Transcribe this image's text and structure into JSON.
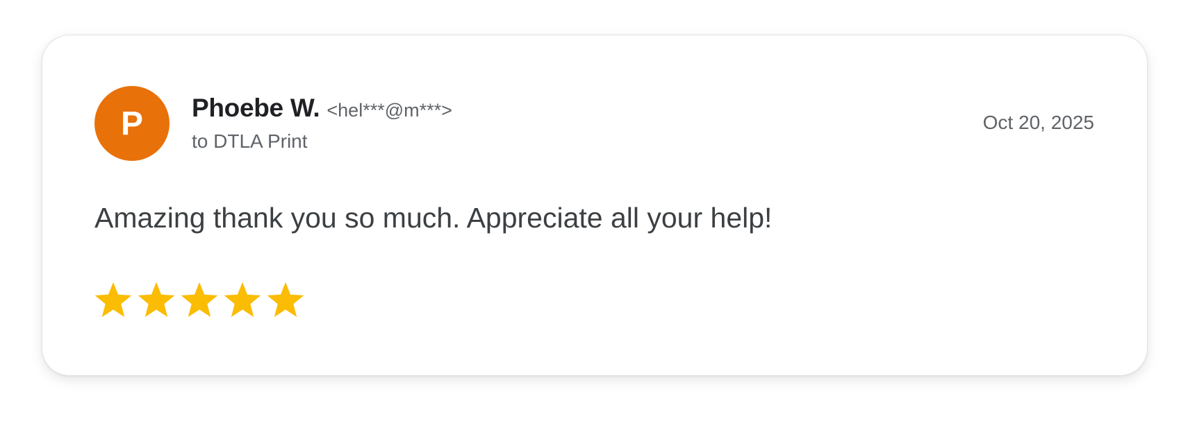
{
  "review": {
    "avatar_initial": "P",
    "sender_name": "Phoebe W.",
    "sender_email": "<hel***@m***>",
    "recipient": "to DTLA Print",
    "date": "Oct 20, 2025",
    "message": "Amazing thank you so much. Appreciate all your help!",
    "rating": 5,
    "rating_max": 5
  },
  "colors": {
    "avatar": "#e8710a",
    "star": "#fbbc04"
  },
  "icons": {
    "rating": "star-icon"
  }
}
